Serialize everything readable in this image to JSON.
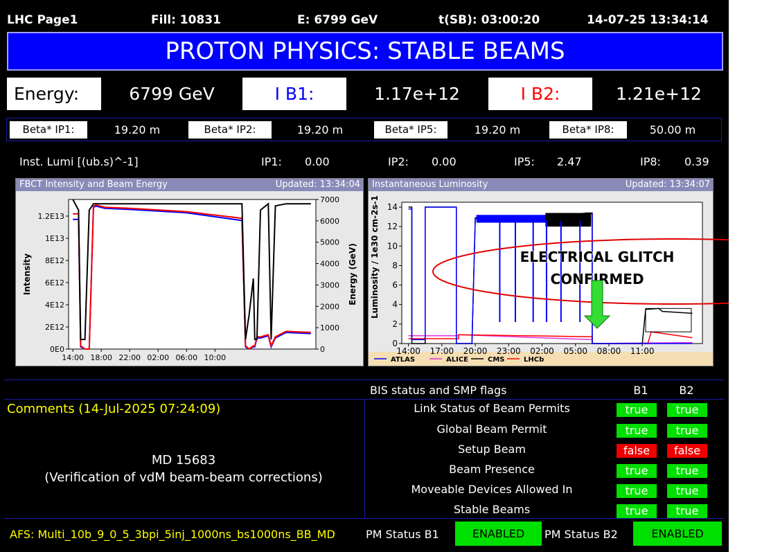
{
  "header": {
    "page": "LHC Page1",
    "fill": "Fill: 10831",
    "energy": "E:  6799 GeV",
    "tsb": "t(SB): 03:00:20",
    "datetime": "14-07-25 13:34:14"
  },
  "mode": "PROTON PHYSICS: STABLE BEAMS",
  "energy_row": {
    "energy_label": "Energy:",
    "energy_value": "6799 GeV",
    "ib1_label": "I B1:",
    "ib1_value": "1.17e+12",
    "ib2_label": "I B2:",
    "ib2_value": "1.21e+12"
  },
  "beta": [
    {
      "label": "Beta* IP1:",
      "value": "19.20 m"
    },
    {
      "label": "Beta* IP2:",
      "value": "19.20 m"
    },
    {
      "label": "Beta* IP5:",
      "value": "19.20 m"
    },
    {
      "label": "Beta* IP8:",
      "value": "50.00 m"
    }
  ],
  "lumi_row": {
    "label": "Inst. Lumi [(ub.s)^-1]",
    "ip1_label": "IP1:",
    "ip1_value": "0.00",
    "ip2_label": "IP2:",
    "ip2_value": "0.00",
    "ip5_label": "IP5:",
    "ip5_value": "2.47",
    "ip8_label": "IP8:",
    "ip8_value": "0.39"
  },
  "fbct_panel": {
    "title": "FBCT Intensity and Beam Energy",
    "updated": "Updated: 13:34:04",
    "ylabel": "Intensity",
    "y2label": "Energy (GeV)",
    "ytick_labels": [
      "0E0",
      "2E12",
      "4E12",
      "6E12",
      "8E12",
      "1E13",
      "1.2E13"
    ],
    "y2tick_labels": [
      "0",
      "1000",
      "2000",
      "3000",
      "4000",
      "5000",
      "6000",
      "7000"
    ],
    "xtick_labels": [
      "14:00",
      "18:00",
      "22:00",
      "02:00",
      "06:00",
      "10:00"
    ]
  },
  "lumi_panel": {
    "title": "Instantaneous Luminosity",
    "updated": "Updated: 13:34:07",
    "ylabel": "Luminosity / 1e30 cm-2s-1",
    "ytick_labels": [
      "0",
      "2",
      "4",
      "6",
      "8",
      "10",
      "12",
      "14"
    ],
    "xtick_labels": [
      "14:00",
      "17:00",
      "20:00",
      "23:00",
      "02:00",
      "05:00",
      "08:00",
      "11:00"
    ],
    "legend": [
      "ATLAS",
      "ALICE",
      "CMS",
      "LHCb"
    ],
    "annotation_line1": "ELECTRICAL GLITCH",
    "annotation_line2": "CONFIRMED"
  },
  "chart_data": [
    {
      "type": "line",
      "title": "FBCT Intensity and Beam Energy",
      "xlabel": "",
      "ylabel": "Intensity",
      "y2label": "Energy (GeV)",
      "ylim": [
        0,
        13500000000000
      ],
      "y2lim": [
        0,
        7000
      ],
      "x_tick_labels": [
        "14:00",
        "18:00",
        "22:00",
        "02:00",
        "06:00",
        "10:00"
      ],
      "x_hours": [
        0,
        0.8,
        1.1,
        1.7,
        2.3,
        2.9,
        3.3,
        4.5,
        8,
        16,
        23.8,
        24.3,
        24.8,
        25.4,
        25.6,
        25.9,
        26.4,
        27.5,
        27.9,
        28.5,
        30,
        33.5
      ],
      "series": [
        {
          "axis": "left",
          "color": "#0000ff",
          "values": [
            11700000000000,
            11700000000000,
            200000000000,
            0,
            0,
            12800000000000,
            12900000000000,
            12700000000000,
            12600000000000,
            12300000000000,
            11600000000000,
            200000000000,
            0,
            200000000000,
            200000000000,
            1000000000000,
            1000000000000,
            1200000000000,
            200000000000,
            1000000000000,
            1500000000000,
            1400000000000
          ]
        },
        {
          "axis": "left",
          "color": "#ff0000",
          "values": [
            12200000000000,
            12200000000000,
            300000000000,
            0,
            0,
            12900000000000,
            13000000000000,
            12800000000000,
            12700000000000,
            12400000000000,
            11800000000000,
            300000000000,
            0,
            300000000000,
            300000000000,
            1100000000000,
            1100000000000,
            1300000000000,
            300000000000,
            1100000000000,
            1600000000000,
            1500000000000
          ]
        },
        {
          "axis": "right",
          "color": "#000000",
          "values": [
            7000,
            6500,
            450,
            450,
            6500,
            6800,
            6800,
            6800,
            6800,
            6800,
            6800,
            450,
            1600,
            3300,
            450,
            450,
            6500,
            6800,
            450,
            6700,
            6800,
            6800
          ]
        }
      ]
    },
    {
      "type": "line",
      "title": "Instantaneous Luminosity",
      "xlabel": "",
      "ylabel": "Luminosity / 1e30 cm-2s-1",
      "ylim": [
        0,
        14.5
      ],
      "x_tick_labels": [
        "14:00",
        "17:00",
        "20:00",
        "23:00",
        "02:00",
        "05:00",
        "08:00",
        "11:00"
      ],
      "legend_position": "bottom",
      "series": [
        {
          "name": "ATLAS",
          "color": "#0000ff",
          "x_hours": [
            0,
            0.3,
            0.3,
            1.5,
            1.5,
            4.3,
            4.3,
            5.7,
            6,
            9,
            12,
            14.5,
            16,
            16.5,
            16.5,
            17.5,
            17.5,
            25.5
          ],
          "values": [
            13.8,
            13.8,
            0.4,
            0.4,
            14,
            14,
            0,
            0,
            12.8,
            12.9,
            13,
            13.2,
            13.3,
            13.3,
            0,
            0,
            0,
            0
          ]
        },
        {
          "name": "ALICE",
          "color": "#dd33dd",
          "x_hours": [
            0,
            4.5,
            4.5,
            16.5,
            16.5,
            25.5
          ],
          "values": [
            0.8,
            0.8,
            0.9,
            0.4,
            0,
            0.1
          ]
        },
        {
          "name": "CMS",
          "color": "#000000",
          "x_hours": [
            0,
            0.3,
            0.3,
            1.5,
            1.5,
            4.3,
            4.3,
            5.7,
            6,
            9,
            12,
            14.5,
            16,
            16.5,
            16.5,
            21,
            21.3,
            22.5,
            22.8,
            25.5
          ],
          "values": [
            14,
            14,
            0,
            0,
            14,
            14,
            0,
            0,
            12.9,
            13,
            13.1,
            13.2,
            13.4,
            13.4,
            0,
            0,
            3.5,
            3.6,
            3.3,
            3.1
          ]
        },
        {
          "name": "LHCb",
          "color": "#ff0000",
          "x_hours": [
            0,
            4.5,
            4.5,
            16.5,
            16.5,
            21.5,
            21.8,
            25.5
          ],
          "values": [
            0.5,
            0.5,
            0.9,
            0.7,
            0,
            0,
            1.2,
            0.6
          ]
        }
      ]
    }
  ],
  "bis": {
    "title": "BIS status and SMP flags",
    "b1": "B1",
    "b2": "B2",
    "rows": [
      {
        "label": "Link Status of Beam Permits",
        "b1": "true",
        "b2": "true"
      },
      {
        "label": "Global Beam Permit",
        "b1": "true",
        "b2": "true"
      },
      {
        "label": "Setup Beam",
        "b1": "false",
        "b2": "false"
      },
      {
        "label": "Beam Presence",
        "b1": "true",
        "b2": "true"
      },
      {
        "label": "Moveable Devices Allowed In",
        "b1": "true",
        "b2": "true"
      },
      {
        "label": "Stable Beams",
        "b1": "true",
        "b2": "true"
      }
    ],
    "true_color": "#00e000",
    "false_color": "#ee0000"
  },
  "comments": {
    "header": "Comments (14-Jul-2025 07:24:09)",
    "line1": "MD 15683",
    "line2": "(Verification of vdM beam-beam corrections)"
  },
  "footer": {
    "afs": "AFS: Multi_10b_9_0_5_3bpi_5inj_1000ns_bs1000ns_BB_MD",
    "pm_b1_label": "PM Status B1",
    "pm_b1_value": "ENABLED",
    "pm_b2_label": "PM Status B2",
    "pm_b2_value": "ENABLED"
  }
}
